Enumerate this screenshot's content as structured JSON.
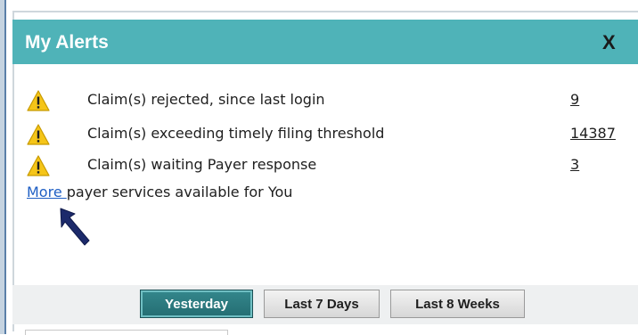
{
  "panel": {
    "title": "My Alerts",
    "close_label": "X"
  },
  "alerts": [
    {
      "icon": "warning-icon",
      "text": "Claim(s) rejected, since last login",
      "count": "9"
    },
    {
      "icon": "warning-icon",
      "text": "Claim(s) exceeding timely filing threshold",
      "count": "14387"
    },
    {
      "icon": "warning-icon",
      "text": "Claim(s) waiting Payer response",
      "count": "3"
    }
  ],
  "more": {
    "link_label": "More ",
    "rest_text": "payer services available for You"
  },
  "footer": {
    "buttons": [
      {
        "label": "Yesterday",
        "active": true
      },
      {
        "label": "Last 7 Days",
        "active": false
      },
      {
        "label": "Last 8 Weeks",
        "active": false
      }
    ]
  },
  "colors": {
    "header_teal": "#4fb3b8",
    "active_button": "#2b7b80",
    "link_blue": "#1f5fc4",
    "warning_yellow": "#f5c518",
    "arrow_navy": "#1c2a6b"
  }
}
